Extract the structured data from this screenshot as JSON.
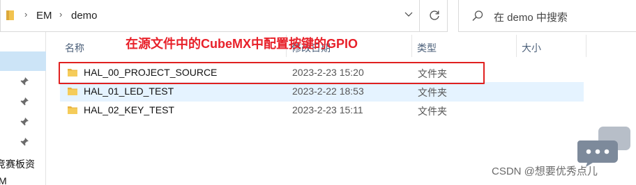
{
  "address": {
    "crumbs": [
      "EM",
      "demo"
    ]
  },
  "search": {
    "placeholder": "在 demo 中搜索"
  },
  "nav": {
    "items": [
      {
        "label": ""
      },
      {
        "label": ""
      },
      {
        "label": ""
      },
      {
        "label": ""
      },
      {
        "label": "竞赛板资"
      },
      {
        "label": "M"
      }
    ]
  },
  "columns": {
    "name": "名称",
    "date": "修改日期",
    "type": "类型",
    "size": "大小"
  },
  "files": [
    {
      "name": "HAL_00_PROJECT_SOURCE",
      "date": "2023-2-23 15:20",
      "type": "文件夹"
    },
    {
      "name": "HAL_01_LED_TEST",
      "date": "2023-2-22 18:53",
      "type": "文件夹"
    },
    {
      "name": "HAL_02_KEY_TEST",
      "date": "2023-2-23 15:11",
      "type": "文件夹"
    }
  ],
  "annotation": "在源文件中的CubeMX中配置按键的GPIO",
  "watermark": "CSDN @想要优秀点儿",
  "colors": {
    "folder": "#f2c34f",
    "highlight": "#e0201f",
    "hover_row": "#e5f3ff",
    "nav_selected": "#cce4f7"
  }
}
